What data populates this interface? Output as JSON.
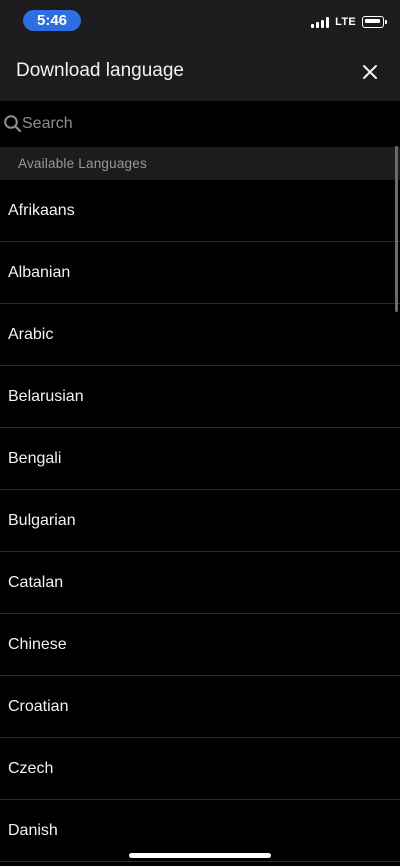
{
  "status_bar": {
    "time": "5:46",
    "network": "LTE"
  },
  "header": {
    "title": "Download language",
    "close_icon": "close-icon"
  },
  "search": {
    "placeholder": "Search",
    "value": "",
    "icon": "search-icon"
  },
  "section": {
    "label": "Available Languages"
  },
  "languages": [
    "Afrikaans",
    "Albanian",
    "Arabic",
    "Belarusian",
    "Bengali",
    "Bulgarian",
    "Catalan",
    "Chinese",
    "Croatian",
    "Czech",
    "Danish"
  ],
  "colors": {
    "accent": "#2d6fe0",
    "header_bg": "#1c1c1e",
    "list_bg": "#000000",
    "separator": "#2c2c2e",
    "secondary_text": "#98989d"
  }
}
